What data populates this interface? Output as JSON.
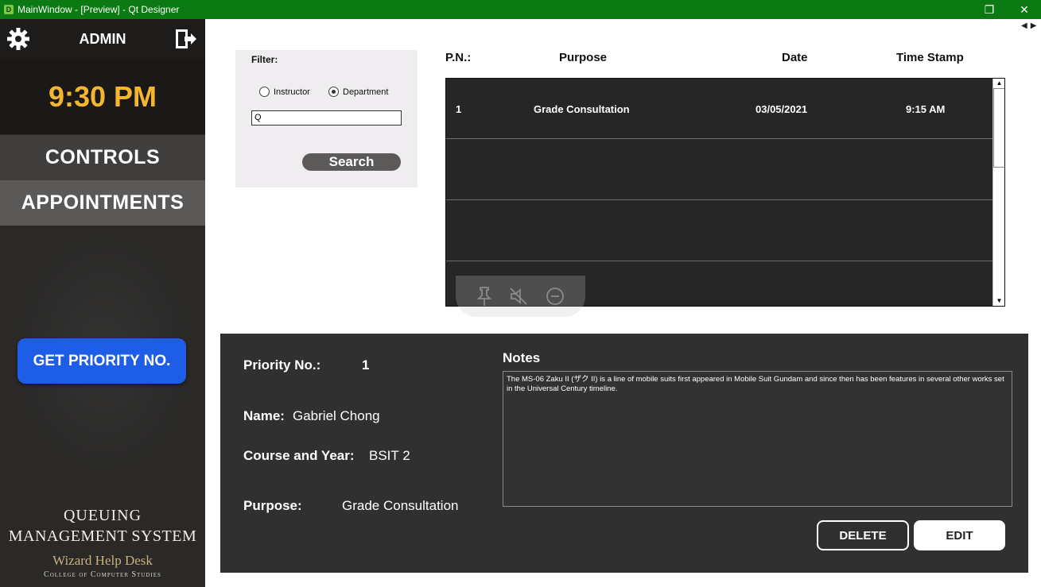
{
  "window": {
    "title": "MainWindow - [Preview] - Qt Designer",
    "app_icon": "D",
    "restore_glyph": "❐",
    "close_glyph": "✕"
  },
  "sidebar": {
    "admin_label": "ADMIN",
    "time": "9:30 PM",
    "nav": {
      "controls": "CONTROLS",
      "appointments": "APPOINTMENTS"
    },
    "priority_button": "GET PRIORITY NO.",
    "brand": {
      "line1": "QUEUING",
      "line2": "MANAGEMENT SYSTEM",
      "line3": "Wizard Help Desk",
      "line4": "College of Computer Studies"
    }
  },
  "filter": {
    "label": "Filter:",
    "options": [
      {
        "label": "Instructor",
        "selected": false
      },
      {
        "label": "Department",
        "selected": true
      }
    ],
    "input_value": "Q",
    "search_label": "Search"
  },
  "table": {
    "headers": [
      "P.N.:",
      "Purpose",
      "Date",
      "Time Stamp"
    ],
    "rows": [
      {
        "pn": "1",
        "purpose": "Grade Consultation",
        "date": "03/05/2021",
        "time": "9:15 AM"
      },
      {
        "pn": "",
        "purpose": "",
        "date": "",
        "time": ""
      },
      {
        "pn": "",
        "purpose": "",
        "date": "",
        "time": ""
      },
      {
        "pn": "",
        "purpose": "",
        "date": "",
        "time": ""
      }
    ]
  },
  "detail": {
    "priority_label": "Priority No.:",
    "priority_value": "1",
    "name_label": "Name:",
    "name_value": "Gabriel Chong",
    "course_label": "Course and Year:",
    "course_value": "BSIT 2",
    "purpose_label": "Purpose:",
    "purpose_value": "Grade Consultation",
    "notes_title": "Notes",
    "notes_text": "The MS-06 Zaku II (ザク II) is a line of mobile suits first appeared in Mobile Suit Gundam and since then has been features in several other works set in the Universal Century timeline.",
    "delete_label": "DELETE",
    "edit_label": "EDIT"
  },
  "icons": {
    "gear": "gear-icon",
    "logout": "logout-door-icon",
    "pin": "pin-icon",
    "mute": "mute-icon",
    "minus": "minus-circle-icon"
  },
  "colors": {
    "titlebar": "#0b7a12",
    "sidebar": "#2a2928",
    "clock": "#f5b62e",
    "priority_button": "#1e5ee6",
    "detail_panel": "#313030",
    "table": "#2a2a2a"
  }
}
